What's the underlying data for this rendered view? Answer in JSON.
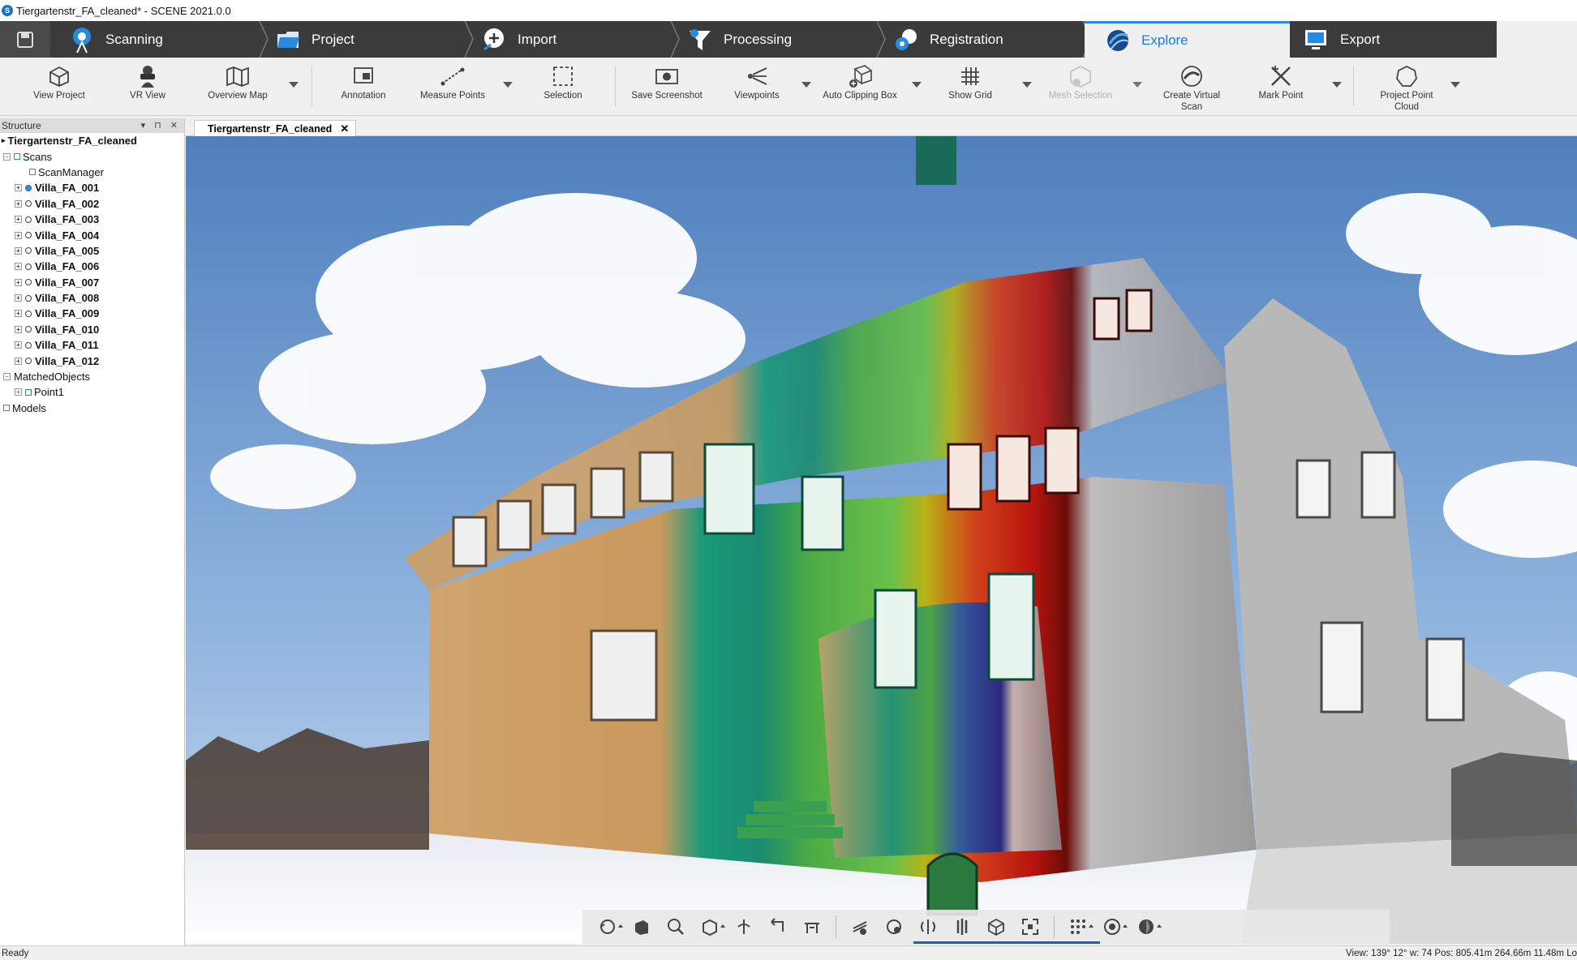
{
  "window": {
    "title": "Tiergartenstr_FA_cleaned* - SCENE 2021.0.0"
  },
  "workflow_tabs": [
    {
      "label": "Scanning",
      "icon": "scanner-icon"
    },
    {
      "label": "Project",
      "icon": "folder-icon"
    },
    {
      "label": "Import",
      "icon": "import-icon"
    },
    {
      "label": "Processing",
      "icon": "filter-icon"
    },
    {
      "label": "Registration",
      "icon": "registration-icon"
    },
    {
      "label": "Explore",
      "icon": "explore-icon",
      "active": true
    },
    {
      "label": "Export",
      "icon": "export-icon"
    }
  ],
  "ribbon": {
    "view_project": "View Project",
    "vr_view": "VR View",
    "overview_map": "Overview Map",
    "annotation": "Annotation",
    "measure_points": "Measure Points",
    "selection": "Selection",
    "save_screenshot": "Save Screenshot",
    "viewpoints": "Viewpoints",
    "auto_clipping_box": "Auto Clipping Box",
    "show_grid": "Show Grid",
    "mesh_selection": "Mesh Selection",
    "create_virtual_scan_1": "Create Virtual",
    "create_virtual_scan_2": "Scan",
    "mark_point": "Mark Point",
    "project_point_cloud_1": "Project Point",
    "project_point_cloud_2": "Cloud"
  },
  "structure": {
    "title": "Structure",
    "root": "Tiergartenstr_FA_cleaned",
    "scans_label": "Scans",
    "scan_manager": "ScanManager",
    "scans": [
      "Villa_FA_001",
      "Villa_FA_002",
      "Villa_FA_003",
      "Villa_FA_004",
      "Villa_FA_005",
      "Villa_FA_006",
      "Villa_FA_007",
      "Villa_FA_008",
      "Villa_FA_009",
      "Villa_FA_010",
      "Villa_FA_011",
      "Villa_FA_012"
    ],
    "matched_objects": "MatchedObjects",
    "point1": "Point1",
    "models": "Models"
  },
  "document": {
    "tab_label": "Tiergartenstr_FA_cleaned",
    "close_glyph": "✕"
  },
  "status": {
    "left": "Ready",
    "right": "View: 139° 12° w: 74 Pos: 805.41m 264.66m 11.48m Lo"
  },
  "colors": {
    "toolbar_dark": "#3b3b3b",
    "active_tab_accent": "#1a7bd8",
    "sky": "#6f9dd2",
    "tan_facade": "#c9a16a",
    "green_facade": "#4aa844",
    "red_facade": "#c81e12",
    "blue_base": "#1a3ea8",
    "gray_scan": "#bfbfbf"
  }
}
